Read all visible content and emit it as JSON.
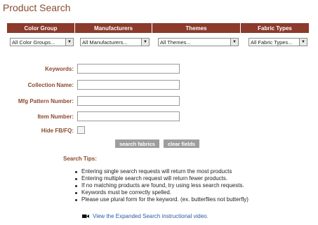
{
  "page": {
    "title": "Product Search"
  },
  "filters": {
    "headers": [
      "Color Group",
      "Manufacturers",
      "Themes",
      "Fabric Types"
    ],
    "selects": [
      "All Color Groups...",
      "All Manufacturers...",
      "All Themes...",
      "All Fabric Types..."
    ]
  },
  "form": {
    "keywords_label": "Keywords:",
    "collection_label": "Collection Name:",
    "mfg_label": "Mfg Pattern Number:",
    "item_label": "Item Number:",
    "hide_label": "Hide FB/FQ:",
    "keywords_value": "",
    "collection_value": "",
    "mfg_value": "",
    "item_value": ""
  },
  "buttons": {
    "search": "search fabrics",
    "clear": "clear fields"
  },
  "tips": {
    "title": "Search Tips:",
    "items": [
      "Entering single search requests will return the most products",
      "Entering multiple search request will return fewer products.",
      "If no matching products are found, try using less search requests.",
      "Keywords must be correctly spelled.",
      "Please use plural form for the keyword. (ex. butterflies not butterfly)"
    ]
  },
  "video": {
    "link_text": "View the Expanded Search instructional video."
  },
  "colors": {
    "header_bg": "#8b3a2b",
    "label": "#8a4a2f",
    "link": "#2c5aa0",
    "button": "#9e9e9e"
  }
}
